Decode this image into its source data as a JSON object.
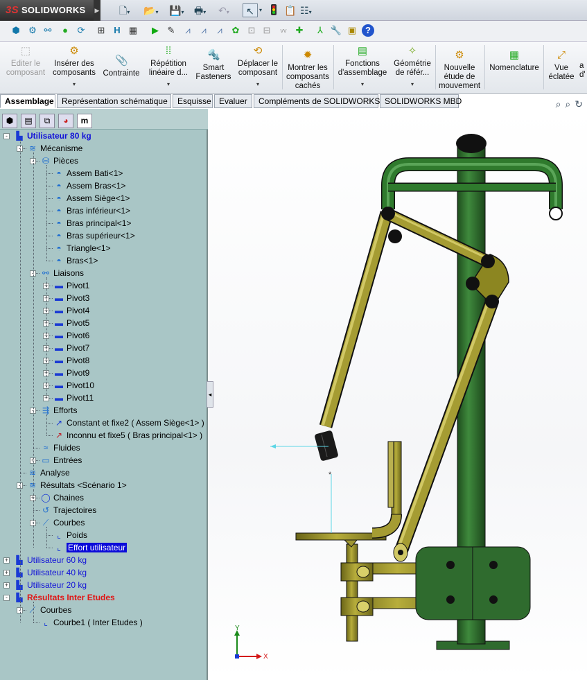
{
  "app": {
    "brand_prefix": "3S",
    "brand": "SOLIDWORKS"
  },
  "quick_access": {
    "icons": [
      "new-icon",
      "open-icon",
      "save-icon",
      "print-icon",
      "undo-icon",
      "select-icon",
      "rebuild-icon",
      "options-icon",
      "file-properties-icon"
    ]
  },
  "toolbar2": {
    "icons": [
      "cube-icon",
      "tree-icon",
      "link-icon",
      "apple-icon",
      "refresh-icon",
      "grid-icon",
      "H-icon",
      "calculator-icon",
      "play-icon",
      "pencil-icon",
      "graph1-icon",
      "graph2-icon",
      "graph3-icon",
      "gear-icon",
      "film-icon",
      "vv-icon",
      "stack-icon",
      "axis-icon",
      "wrench-icon",
      "monitor-icon",
      "help-icon"
    ]
  },
  "ribbon": {
    "items": [
      {
        "label": "Editer le composant",
        "disabled": true,
        "dropdown": false
      },
      {
        "label": "Insérer des composants",
        "disabled": false,
        "dropdown": true
      },
      {
        "label": "Contrainte",
        "disabled": false,
        "dropdown": false
      },
      {
        "label": "Répétition linéaire d...",
        "disabled": false,
        "dropdown": true
      },
      {
        "label": "Smart Fasteners",
        "disabled": false,
        "dropdown": false
      },
      {
        "label": "Déplacer le composant",
        "disabled": false,
        "dropdown": true
      },
      {
        "label": "Montrer les composants cachés",
        "disabled": false,
        "dropdown": false
      },
      {
        "label": "Fonctions d'assemblage",
        "disabled": false,
        "dropdown": true
      },
      {
        "label": "Géométrie de référ...",
        "disabled": false,
        "dropdown": true
      },
      {
        "label": "Nouvelle étude de mouvement",
        "disabled": false,
        "dropdown": false
      },
      {
        "label": "Nomenclature",
        "disabled": false,
        "dropdown": false
      },
      {
        "label": "Vue éclatée",
        "disabled": false,
        "dropdown": false
      },
      {
        "label": "a d'",
        "disabled": false,
        "dropdown": false
      }
    ]
  },
  "tabs": [
    "Assemblage",
    "Représentation schématique",
    "Esquisse",
    "Evaluer",
    "Compléments de SOLIDWORKS",
    "SOLIDWORKS MBD"
  ],
  "active_tab": "Assemblage",
  "tree": [
    {
      "label": "Utilisateur 80 kg",
      "style": "blue-bold",
      "icon": "assembly-icon"
    },
    {
      "label": "Mécanisme",
      "style": "",
      "icon": "mechanism-icon"
    },
    {
      "label": "Pièces",
      "style": "",
      "icon": "parts-icon"
    },
    {
      "label": "Assem Bati<1>",
      "style": "",
      "icon": "part-icon"
    },
    {
      "label": "Assem Bras<1>",
      "style": "",
      "icon": "part-icon"
    },
    {
      "label": "Assem Siège<1>",
      "style": "",
      "icon": "part-icon"
    },
    {
      "label": "Bras inférieur<1>",
      "style": "",
      "icon": "part-icon"
    },
    {
      "label": "Bras principal<1>",
      "style": "",
      "icon": "part-icon"
    },
    {
      "label": "Bras supérieur<1>",
      "style": "",
      "icon": "part-icon"
    },
    {
      "label": "Triangle<1>",
      "style": "",
      "icon": "part-icon"
    },
    {
      "label": "Bras<1>",
      "style": "",
      "icon": "part-icon"
    },
    {
      "label": "Liaisons",
      "style": "",
      "icon": "links-icon"
    },
    {
      "label": "Pivot1",
      "style": "",
      "icon": "pivot-icon"
    },
    {
      "label": "Pivot3",
      "style": "",
      "icon": "pivot-icon"
    },
    {
      "label": "Pivot4",
      "style": "",
      "icon": "pivot-icon"
    },
    {
      "label": "Pivot5",
      "style": "",
      "icon": "pivot-icon"
    },
    {
      "label": "Pivot6",
      "style": "",
      "icon": "pivot-icon"
    },
    {
      "label": "Pivot7",
      "style": "",
      "icon": "pivot-icon"
    },
    {
      "label": "Pivot8",
      "style": "",
      "icon": "pivot-icon"
    },
    {
      "label": "Pivot9",
      "style": "",
      "icon": "pivot-icon"
    },
    {
      "label": "Pivot10",
      "style": "",
      "icon": "pivot-icon"
    },
    {
      "label": "Pivot11",
      "style": "",
      "icon": "pivot-icon"
    },
    {
      "label": "Efforts",
      "style": "",
      "icon": "forces-icon"
    },
    {
      "label": "Constant et fixe2 ( Assem Siège<1> )",
      "style": "",
      "icon": "force-arrow-icon"
    },
    {
      "label": "Inconnu et fixe5 ( Bras principal<1> )",
      "style": "",
      "icon": "force-arrow-red-icon"
    },
    {
      "label": "Fluides",
      "style": "",
      "icon": "fluids-icon"
    },
    {
      "label": "Entrées",
      "style": "",
      "icon": "inputs-icon"
    },
    {
      "label": "Analyse",
      "style": "",
      "icon": "analysis-icon"
    },
    {
      "label": "Résultats <Scénario 1>",
      "style": "",
      "icon": "results-icon"
    },
    {
      "label": "Chaines",
      "style": "",
      "icon": "chains-icon"
    },
    {
      "label": "Trajectoires",
      "style": "",
      "icon": "trajectories-icon"
    },
    {
      "label": "Courbes",
      "style": "",
      "icon": "curves-icon"
    },
    {
      "label": "Poids",
      "style": "",
      "icon": "curve-icon"
    },
    {
      "label": "Effort utilisateur",
      "style": "selected",
      "icon": "curve-icon"
    },
    {
      "label": "Utilisateur 60 kg",
      "style": "blue",
      "icon": "assembly-icon"
    },
    {
      "label": "Utilisateur 40 kg",
      "style": "blue",
      "icon": "assembly-icon"
    },
    {
      "label": "Utilisateur 20 kg",
      "style": "blue",
      "icon": "assembly-icon"
    },
    {
      "label": "Résultats Inter Etudes",
      "style": "red",
      "icon": "assembly-icon"
    },
    {
      "label": "Courbes",
      "style": "",
      "icon": "curves-icon"
    },
    {
      "label": "Courbe1 ( Inter Etudes )",
      "style": "",
      "icon": "curve-icon"
    }
  ],
  "viewport": {
    "triad_labels": [
      "Y",
      "X"
    ],
    "machine_colors": {
      "frame": "#2f6b2e",
      "arm": "#8c8621",
      "pivot": "#111111"
    }
  }
}
